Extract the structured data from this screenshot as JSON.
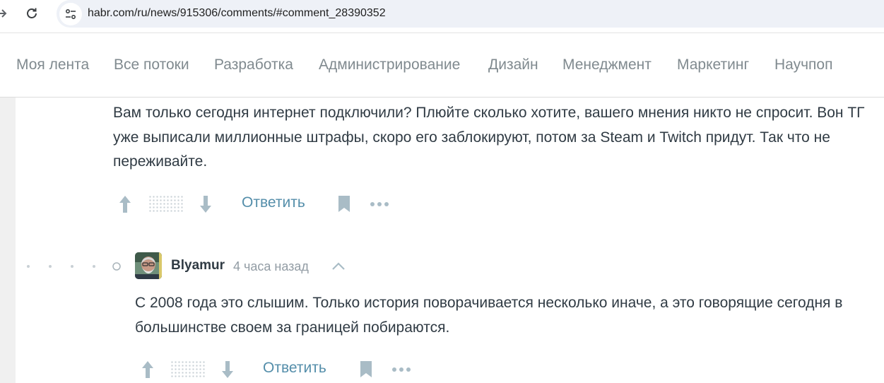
{
  "browser": {
    "url": "habr.com/ru/news/915306/comments/#comment_28390352"
  },
  "hubs": [
    "Моя лента",
    "Все потоки",
    "Разработка",
    "Администрирование",
    "Дизайн",
    "Менеджмент",
    "Маркетинг",
    "Научпоп"
  ],
  "comments": [
    {
      "body": "Вам только сегодня интернет подключили? Плюйте сколько хотите, вашего мнения никто не спросит. Вон ТГ уже выписали миллионные штрафы, скоро его заблокируют, потом за Steam и Twitch придут. Так что не переживайте.",
      "reply_label": "Ответить"
    },
    {
      "author": "Blyamur",
      "time": "4 часа назад",
      "body": "С 2008 года это слышим. Только история поворачивается несколько иначе, а это говорящие сегодня в большинстве своем за границей побираются.",
      "reply_label": "Ответить"
    }
  ],
  "colors": {
    "accent_link": "#548eaa",
    "text": "#303b44",
    "muted": "#929ca4",
    "icon": "#a9bcc6"
  },
  "icons": [
    "arrow-forward-icon",
    "reload-icon",
    "site-info-icon",
    "vote-up-icon",
    "vote-down-icon",
    "bookmark-icon",
    "more-icon",
    "chevron-up-icon"
  ]
}
